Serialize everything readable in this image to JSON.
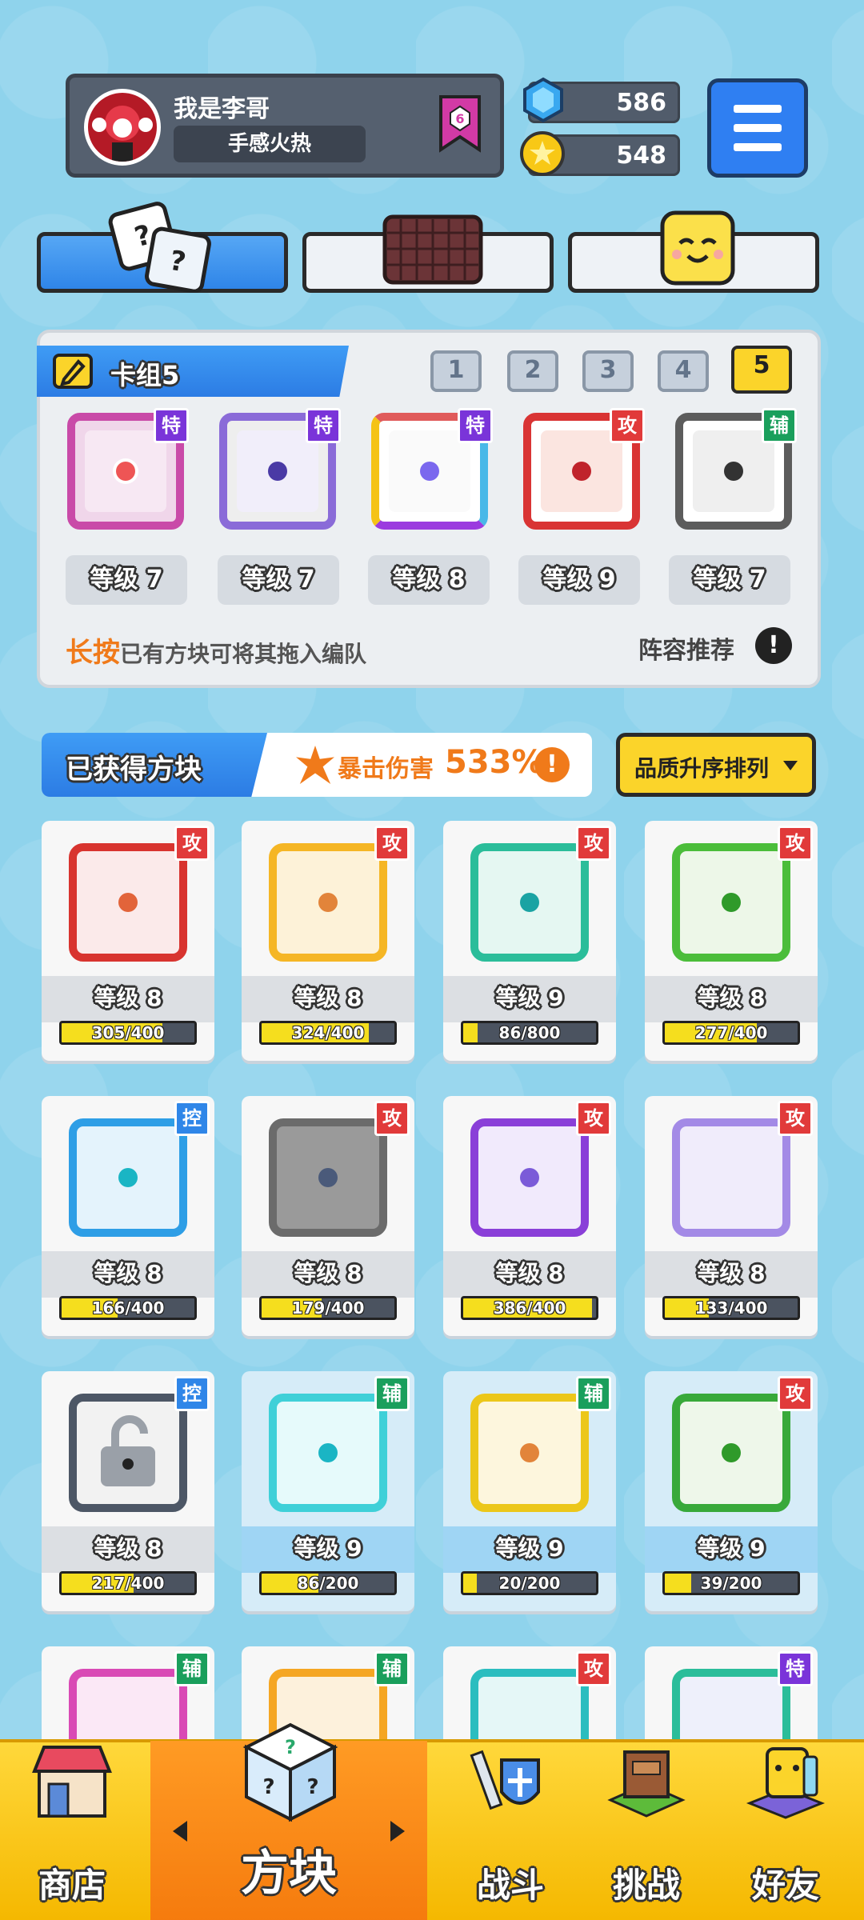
{
  "profile": {
    "name": "我是李哥",
    "title": "手感火热",
    "rank": "6"
  },
  "currency": {
    "gems": "586",
    "coins": "548"
  },
  "deck": {
    "title": "卡组5",
    "tabs": [
      "1",
      "2",
      "3",
      "4",
      "5"
    ],
    "selected": "5",
    "cards": [
      {
        "tag": "特",
        "level": "等级 7"
      },
      {
        "tag": "特",
        "level": "等级 7"
      },
      {
        "tag": "特",
        "level": "等级 8"
      },
      {
        "tag": "攻",
        "level": "等级 9"
      },
      {
        "tag": "辅",
        "level": "等级 7"
      }
    ],
    "hint_highlight": "长按",
    "hint_text": "已有方块可将其拖入编队",
    "recommend": "阵容推荐"
  },
  "obtained": {
    "title": "已获得方块",
    "crit_label": "暴击伤害",
    "crit_value": "533%",
    "sort_label": "品质升序排列"
  },
  "cards": [
    {
      "tag": "攻",
      "level": "等级 8",
      "progress": "305/400",
      "ratio": 0.76
    },
    {
      "tag": "攻",
      "level": "等级 8",
      "progress": "324/400",
      "ratio": 0.81
    },
    {
      "tag": "攻",
      "level": "等级 9",
      "progress": "86/800",
      "ratio": 0.11
    },
    {
      "tag": "攻",
      "level": "等级 8",
      "progress": "277/400",
      "ratio": 0.69
    },
    {
      "tag": "控",
      "level": "等级 8",
      "progress": "166/400",
      "ratio": 0.42
    },
    {
      "tag": "攻",
      "level": "等级 8",
      "progress": "179/400",
      "ratio": 0.45
    },
    {
      "tag": "攻",
      "level": "等级 8",
      "progress": "386/400",
      "ratio": 0.97
    },
    {
      "tag": "攻",
      "level": "等级 8",
      "progress": "133/400",
      "ratio": 0.33
    },
    {
      "tag": "控",
      "level": "等级 8",
      "progress": "217/400",
      "ratio": 0.54
    },
    {
      "tag": "辅",
      "level": "等级 9",
      "progress": "86/200",
      "ratio": 0.43
    },
    {
      "tag": "辅",
      "level": "等级 9",
      "progress": "20/200",
      "ratio": 0.1
    },
    {
      "tag": "攻",
      "level": "等级 9",
      "progress": "39/200",
      "ratio": 0.2
    },
    {
      "tag": "辅"
    },
    {
      "tag": "辅"
    },
    {
      "tag": "攻"
    },
    {
      "tag": "特"
    }
  ],
  "nav": {
    "shop": "商店",
    "blocks": "方块",
    "battle": "战斗",
    "challenge": "挑战",
    "friends": "好友"
  }
}
